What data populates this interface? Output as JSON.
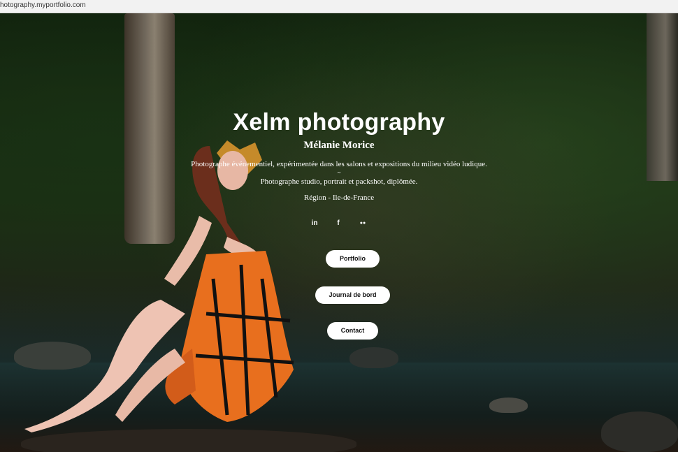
{
  "browser": {
    "url": "hotography.myportfolio.com"
  },
  "site": {
    "title": "Xelm photography",
    "name": "Mélanie Morice",
    "line1": "Photographe événementiel, expérimentée dans les salons et expositions du milieu vidéo ludique.",
    "separator": "~",
    "line2": "Photographe studio, portrait et packshot, diplômée.",
    "region": "Région - Ile-de-France"
  },
  "social": [
    {
      "icon": "linkedin-icon",
      "glyph": "in"
    },
    {
      "icon": "facebook-icon",
      "glyph": "f"
    },
    {
      "icon": "flickr-icon",
      "glyph": "●●"
    }
  ],
  "buttons": {
    "portfolio": "Portfolio",
    "journal": "Journal de bord",
    "contact": "Contact"
  },
  "colors": {
    "button_bg": "#ffffff",
    "text": "#ffffff"
  }
}
